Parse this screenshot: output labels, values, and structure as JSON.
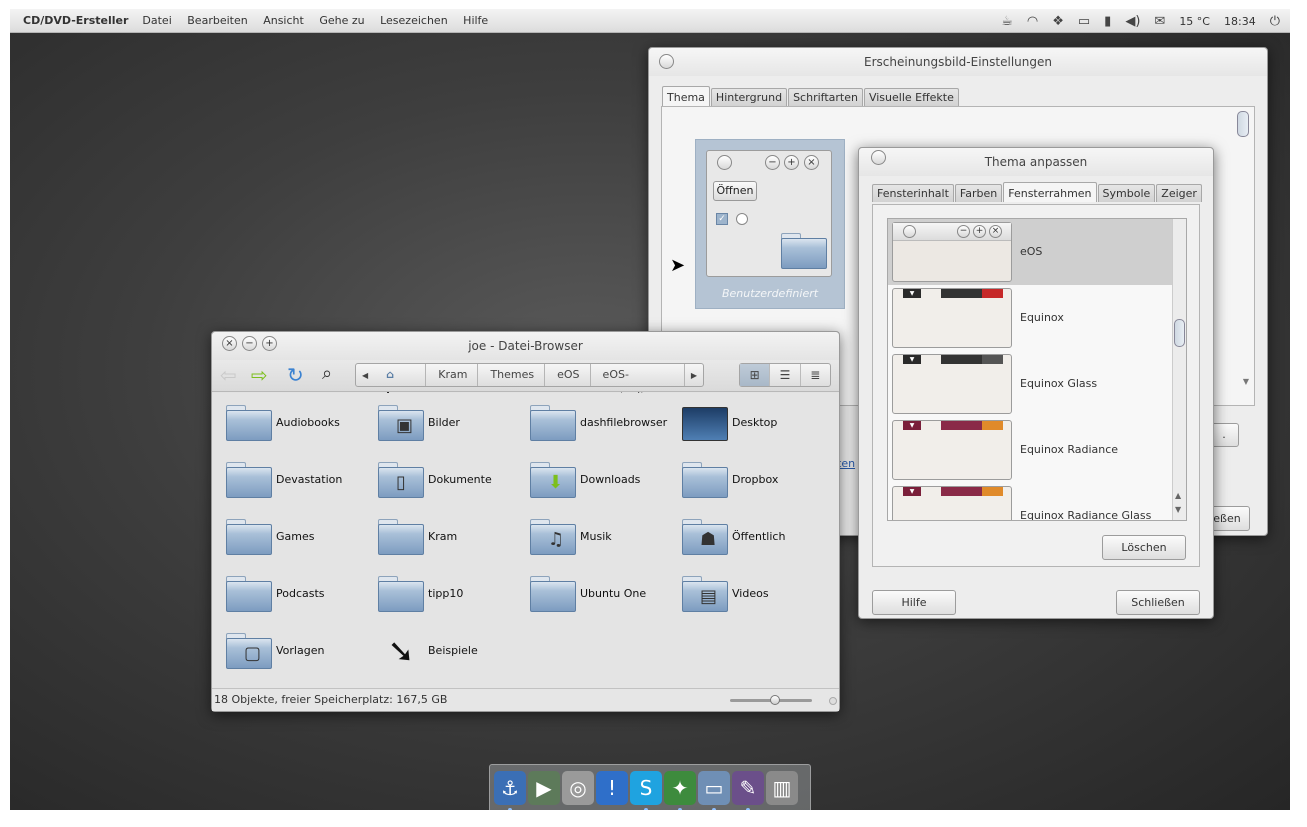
{
  "topbar": {
    "app_name": "CD/DVD-Ersteller",
    "menu": [
      "Datei",
      "Bearbeiten",
      "Ansicht",
      "Gehe zu",
      "Lesezeichen",
      "Hilfe"
    ],
    "temperature": "15 °C",
    "time": "18:34"
  },
  "appearance": {
    "title": "Erscheinungsbild-Einstellungen",
    "tabs": [
      "Thema",
      "Hintergrund",
      "Schriftarten",
      "Visuelle Effekte"
    ],
    "preview": {
      "open_button": "Öffnen",
      "caption": "Benutzerdefiniert"
    },
    "partial_link": "ten",
    "partial_close": "eßen"
  },
  "theme_dialog": {
    "title": "Thema anpassen",
    "tabs": [
      "Fensterinhalt",
      "Farben",
      "Fensterrahmen",
      "Symbole",
      "Zeiger"
    ],
    "themes": [
      {
        "name": "eOS",
        "selected": true,
        "bar_color": "#dcdcdc"
      },
      {
        "name": "Equinox",
        "selected": false,
        "bar_color": "#2a2a2a"
      },
      {
        "name": "Equinox Glass",
        "selected": false,
        "bar_color": "#2a2a2a"
      },
      {
        "name": "Equinox Radiance",
        "selected": false,
        "bar_color": "#7a1f3a"
      },
      {
        "name": "Equinox Radiance Glass",
        "selected": false,
        "bar_color": "#7a1f3a"
      }
    ],
    "delete_button": "Löschen",
    "help_button": "Hilfe",
    "close_button": "Schließen"
  },
  "file_browser": {
    "title": "joe - Datei-Browser",
    "path": [
      "joe",
      "Kram",
      "Themes",
      "eOS",
      "eOS-metacity"
    ],
    "items": [
      {
        "name": "Audiobooks",
        "icon": "folder-icon",
        "badge": ""
      },
      {
        "name": "Bilder",
        "icon": "pictures-folder-icon",
        "badge": "▣"
      },
      {
        "name": "dashfilebrowser",
        "icon": "folder-icon",
        "badge": ""
      },
      {
        "name": "Desktop",
        "icon": "desktop-folder-icon",
        "badge": ""
      },
      {
        "name": "Devastation",
        "icon": "folder-icon",
        "badge": ""
      },
      {
        "name": "Dokumente",
        "icon": "documents-folder-icon",
        "badge": "▯"
      },
      {
        "name": "Downloads",
        "icon": "downloads-folder-icon",
        "badge": "⬇"
      },
      {
        "name": "Dropbox",
        "icon": "folder-icon",
        "badge": ""
      },
      {
        "name": "Games",
        "icon": "folder-icon",
        "badge": ""
      },
      {
        "name": "Kram",
        "icon": "folder-icon",
        "badge": ""
      },
      {
        "name": "Musik",
        "icon": "music-folder-icon",
        "badge": "♫"
      },
      {
        "name": "Öffentlich",
        "icon": "public-folder-icon",
        "badge": "☗"
      },
      {
        "name": "Podcasts",
        "icon": "folder-icon",
        "badge": ""
      },
      {
        "name": "tipp10",
        "icon": "folder-icon",
        "badge": ""
      },
      {
        "name": "Ubuntu One",
        "icon": "folder-icon",
        "badge": ""
      },
      {
        "name": "Videos",
        "icon": "videos-folder-icon",
        "badge": "▤"
      },
      {
        "name": "Vorlagen",
        "icon": "templates-folder-icon",
        "badge": "▢"
      },
      {
        "name": "Beispiele",
        "icon": "link-arrow-icon",
        "badge": "➘"
      }
    ],
    "status": "18 Objekte, freier Speicherplatz: 167,5 GB",
    "zoom_level": 0.55
  },
  "dock": {
    "apps": [
      {
        "name": "anchor-icon",
        "glyph": "⚓",
        "bg": "#3b6fb5",
        "running": true
      },
      {
        "name": "media-player-icon",
        "glyph": "▶",
        "bg": "#5d7a5a",
        "running": false
      },
      {
        "name": "harddisk-icon",
        "glyph": "◎",
        "bg": "#9a9a9a",
        "running": false
      },
      {
        "name": "notification-icon",
        "glyph": "!",
        "bg": "#2f6fc9",
        "running": false
      },
      {
        "name": "skype-icon",
        "glyph": "S",
        "bg": "#1fa3e0",
        "running": true
      },
      {
        "name": "compass-icon",
        "glyph": "✦",
        "bg": "#3d8b3d",
        "running": true
      },
      {
        "name": "file-browser-icon",
        "glyph": "▭",
        "bg": "#6f8fb5",
        "running": true
      },
      {
        "name": "appearance-icon",
        "glyph": "✎",
        "bg": "#6b4f8a",
        "running": true
      },
      {
        "name": "trash-icon",
        "glyph": "▥",
        "bg": "#8a8a8a",
        "running": false
      }
    ]
  }
}
